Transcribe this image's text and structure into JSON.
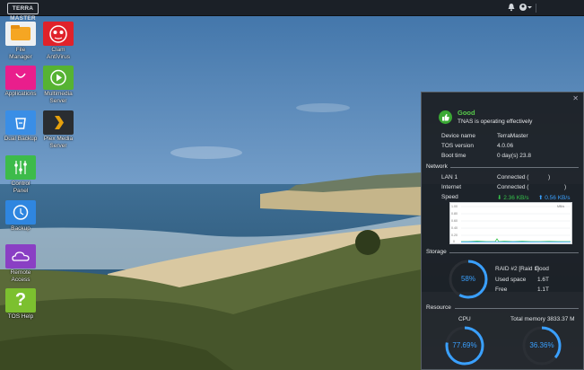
{
  "topbar": {
    "logo_text": "TERRA MASTER",
    "icons": [
      "bell-icon",
      "user-icon",
      "chevron-down-icon"
    ]
  },
  "desktop": {
    "apps": [
      {
        "label": "File\nManager",
        "icon": "folder-icon",
        "color": "#f5a623"
      },
      {
        "label": "Clam\nAntiVirus",
        "icon": "clamav-icon",
        "color": "#e0222a"
      },
      {
        "label": "Applications",
        "icon": "shopping-bag-icon",
        "color": "#e91e8c"
      },
      {
        "label": "Multimedia\nServer",
        "icon": "play-icon",
        "color": "#56b332"
      },
      {
        "label": "Dual Backup",
        "icon": "backup-bucket-icon",
        "color": "#3a8ee6"
      },
      {
        "label": "Plex Media\nServer",
        "icon": "plex-icon",
        "color": "#2a2d31"
      },
      {
        "label": "Control\nPanel",
        "icon": "sliders-icon",
        "color": "#3dbb4a"
      },
      {
        "label": "Backup",
        "icon": "clock-icon",
        "color": "#2f86e0"
      },
      {
        "label": "Remote\nAccess",
        "icon": "cloud-icon",
        "color": "#8a3fc4"
      },
      {
        "label": "TOS Help",
        "icon": "question-icon",
        "color": "#7cc02f"
      }
    ]
  },
  "widget": {
    "status_title": "Good",
    "status_sub": "TNAS is operating effectively",
    "device": [
      {
        "k": "Device name",
        "v": "TerraMaster"
      },
      {
        "k": "TOS version",
        "v": "4.0.06"
      },
      {
        "k": "Boot time",
        "v": "0 day(s) 23.8"
      }
    ],
    "network_title": "Network",
    "network": [
      {
        "k": "LAN 1",
        "v": "Connected (",
        "tail": ")"
      },
      {
        "k": "Internet",
        "v": "Connected (",
        "tail": ")"
      }
    ],
    "speed_label": "Speed",
    "down_speed": "2.36 KB/s",
    "up_speed": "0.56 KB/s",
    "graph_unit": "MB/s",
    "graph_yticks": [
      "1.00",
      "0.80",
      "0.60",
      "0.40",
      "0.20",
      "0"
    ],
    "storage_title": "Storage",
    "storage_pct_text": "58%",
    "storage_pct": 0.58,
    "storage_rows": [
      {
        "k": "RAID #2 [Raid 1]",
        "v": "Good"
      },
      {
        "k": "Used space",
        "v": "1.6T"
      },
      {
        "k": "Free",
        "v": "1.1T"
      }
    ],
    "resource_title": "Resource",
    "cpu_label": "CPU",
    "cpu_pct_text": "77.69%",
    "cpu_pct": 0.7769,
    "mem_label": "Total memory 3833.37 M",
    "mem_pct_text": "36.36%",
    "mem_pct": 0.3636,
    "accent": "#3aa0ff",
    "good_color": "#57c94a"
  }
}
